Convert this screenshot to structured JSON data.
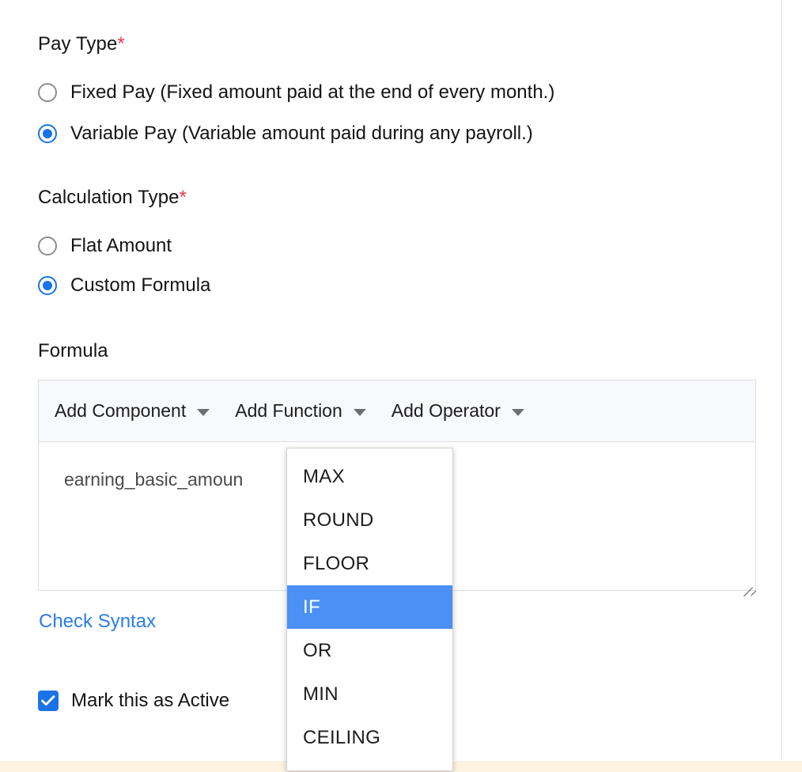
{
  "form": {
    "pay_type": {
      "label": "Pay Type",
      "required_marker": "*",
      "options": [
        {
          "label": "Fixed Pay",
          "hint": "(Fixed amount paid at the end of every month.)",
          "selected": false
        },
        {
          "label": "Variable Pay",
          "hint": "(Variable amount paid during any payroll.)",
          "selected": true
        }
      ]
    },
    "calculation_type": {
      "label": "Calculation Type",
      "required_marker": "*",
      "options": [
        {
          "label": "Flat Amount",
          "hint": "",
          "selected": false
        },
        {
          "label": "Custom Formula",
          "hint": "",
          "selected": true
        }
      ]
    },
    "formula": {
      "label": "Formula",
      "toolbar": {
        "add_component": "Add Component",
        "add_function": "Add Function",
        "add_operator": "Add Operator"
      },
      "value": "earning_basic_amoun",
      "check_syntax": "Check Syntax"
    },
    "active": {
      "label": "Mark this as Active",
      "checked": true
    }
  },
  "function_dropdown": {
    "open": true,
    "selected": "IF",
    "items": [
      {
        "label": "MAX"
      },
      {
        "label": "ROUND"
      },
      {
        "label": "FLOOR"
      },
      {
        "label": "IF"
      },
      {
        "label": "OR"
      },
      {
        "label": "MIN"
      },
      {
        "label": "CEILING"
      }
    ]
  },
  "colors": {
    "accent_blue": "#1a73e8",
    "highlight_blue": "#4a90f5",
    "link_blue": "#2b7de9",
    "required_red": "#e8384f",
    "toolbar_bg": "#f8f9fc",
    "border_gray": "#dcdfe3",
    "bottom_strip": "#fdf3e0"
  }
}
